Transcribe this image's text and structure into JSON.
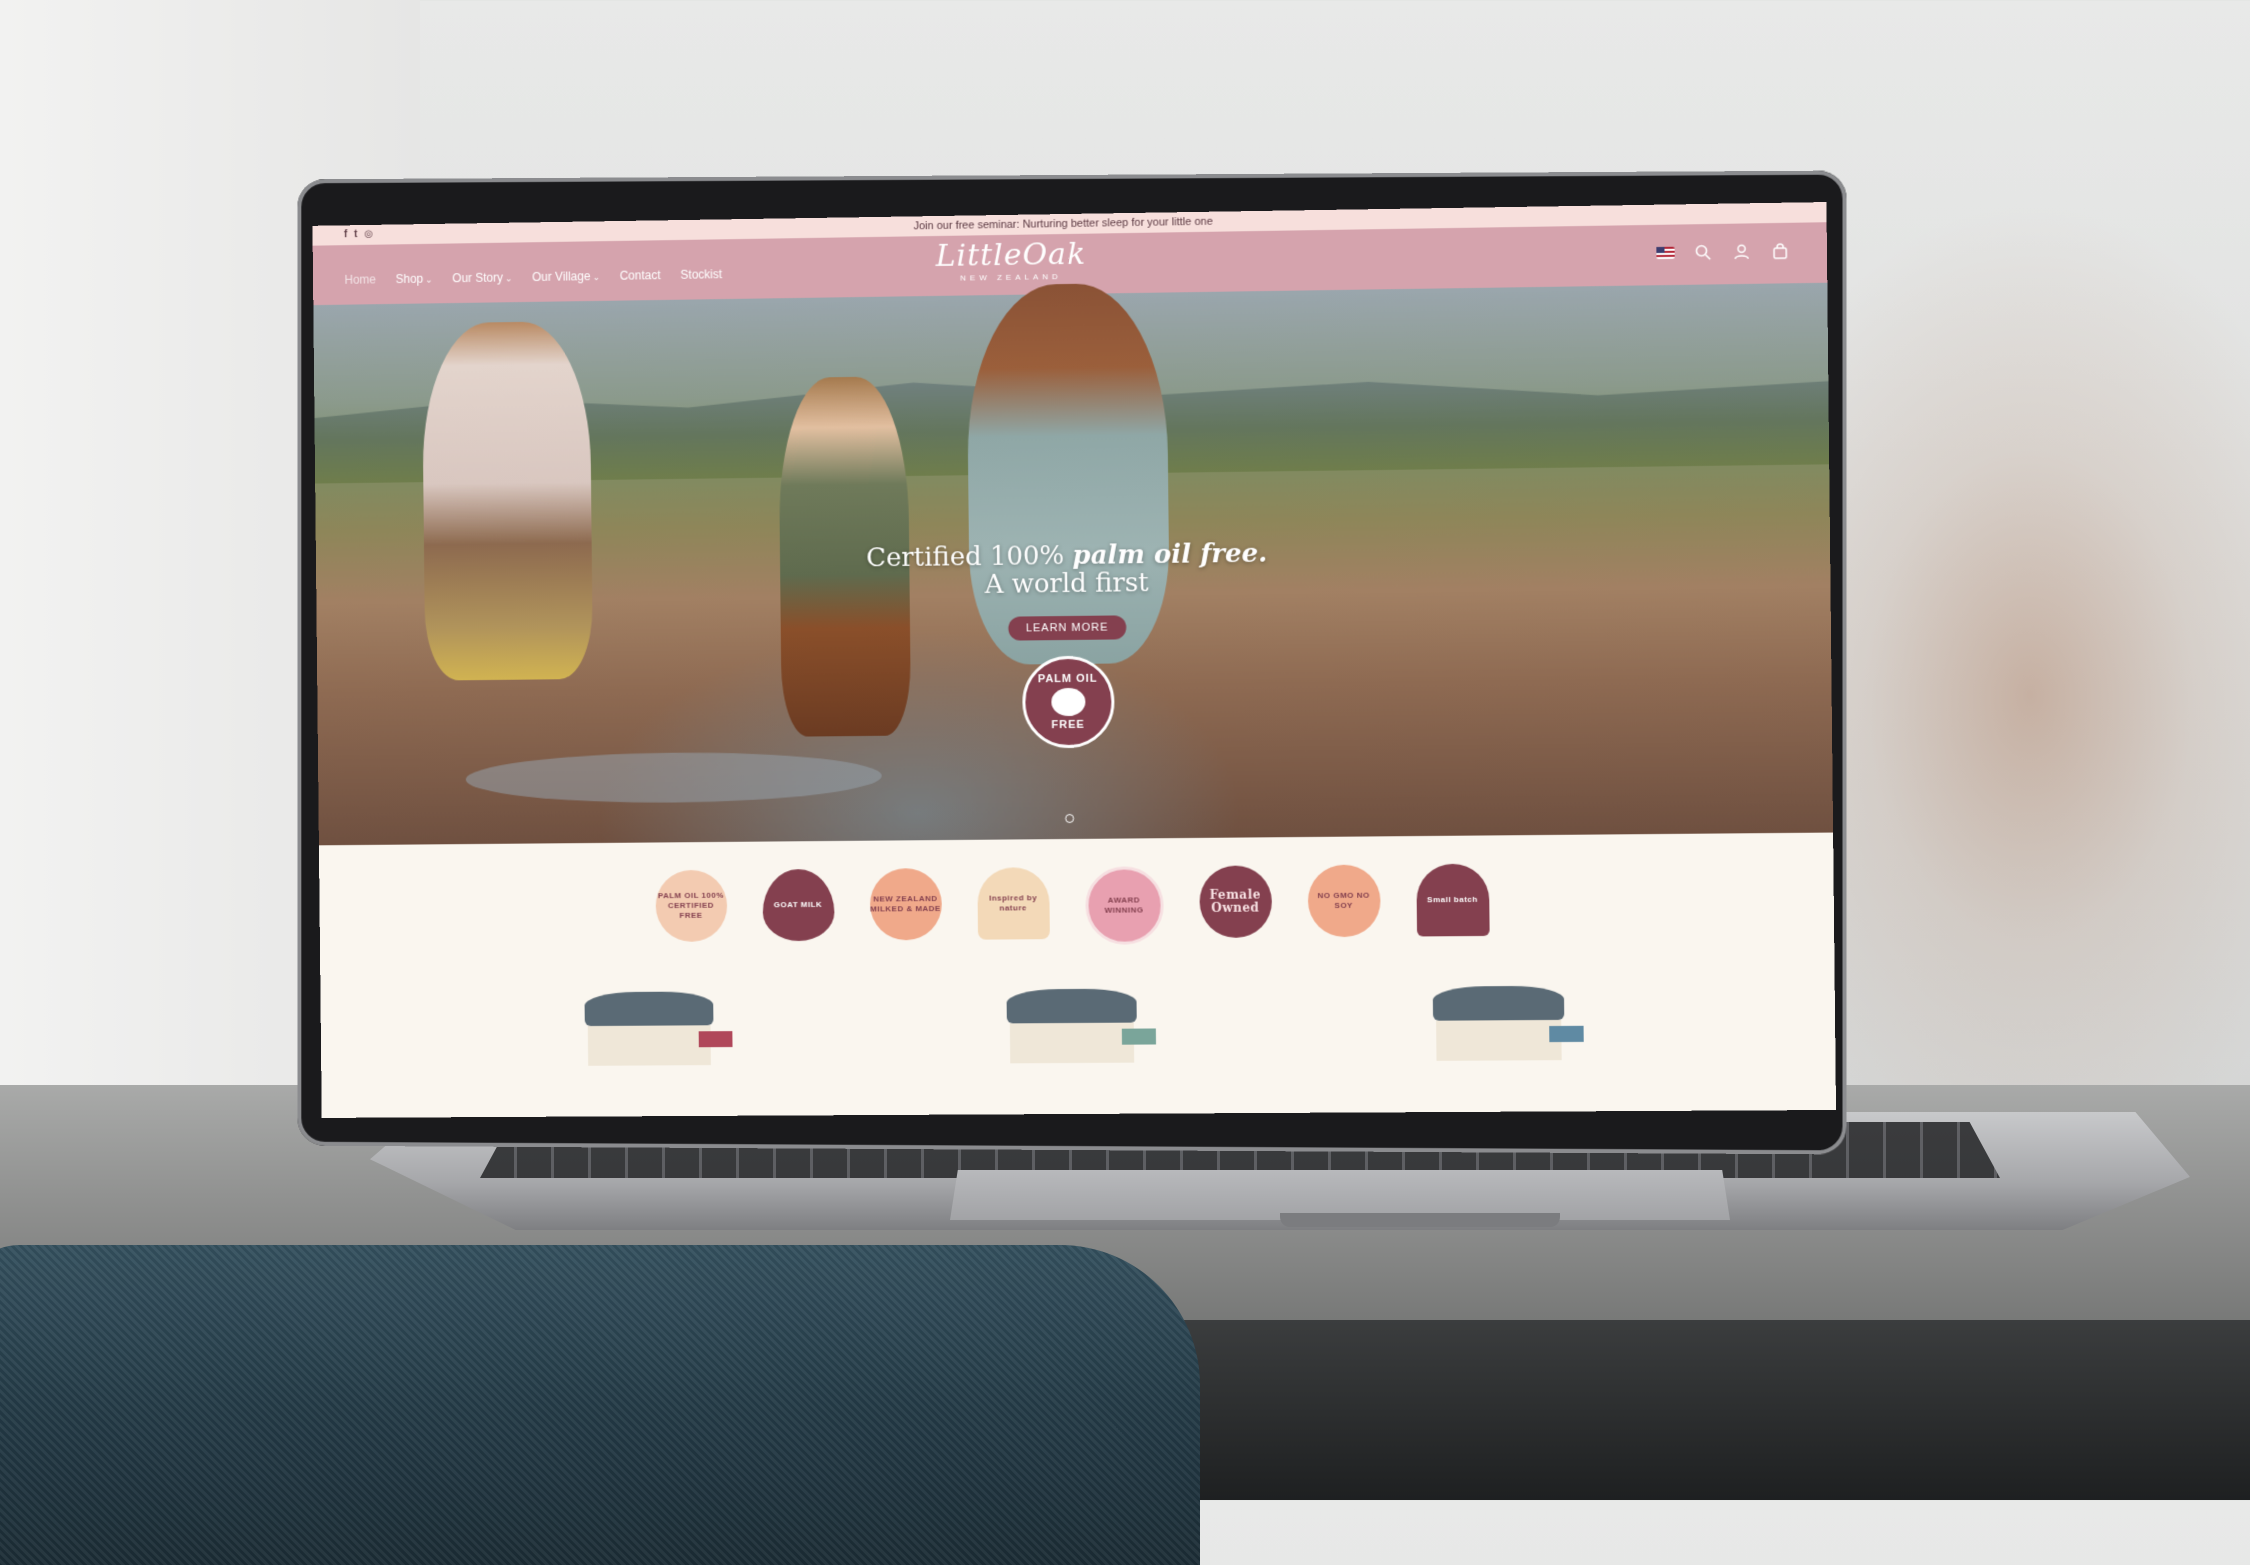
{
  "announcement": "Join our free seminar: Nurturing better sleep for your little one",
  "social": [
    {
      "icon": "facebook-icon",
      "glyph": "f"
    },
    {
      "icon": "twitter-icon",
      "glyph": "t"
    },
    {
      "icon": "instagram-icon",
      "glyph": "◎"
    }
  ],
  "nav": {
    "home": "Home",
    "shop": "Shop",
    "our_story": "Our Story",
    "our_village": "Our Village",
    "contact": "Contact",
    "stockist": "Stockist"
  },
  "brand": {
    "name": "LittleOak",
    "sub": "NEW ZEALAND"
  },
  "header_icons": [
    "flag-icon",
    "search-icon",
    "account-icon",
    "cart-icon"
  ],
  "hero": {
    "line1_prefix": "Certified 100%",
    "line1_bold": "palm oil free.",
    "line2": "A world first",
    "cta": "LEARN MORE",
    "seal_top": "PALM OIL",
    "seal_bottom": "FREE"
  },
  "badges": [
    {
      "text": "PALM OIL 100% CERTIFIED FREE",
      "style": "b-peach"
    },
    {
      "text": "GOAT MILK",
      "style": "b-heart"
    },
    {
      "text": "NEW ZEALAND MILKED & MADE",
      "style": "b-orange"
    },
    {
      "text": "Inspired by nature",
      "style": "b-cream"
    },
    {
      "text": "AWARD WINNING",
      "style": "b-pink"
    },
    {
      "text": "Female Owned",
      "style": "b-plum"
    },
    {
      "text": "NO GMO NO SOY",
      "style": "b-orange"
    },
    {
      "text": "Small batch",
      "style": "b-plum2"
    }
  ],
  "colors": {
    "header": "#d5a3ad",
    "announcement_bg": "#f7dfdc",
    "accent": "#84404f",
    "page_bg": "#faf6ef"
  }
}
